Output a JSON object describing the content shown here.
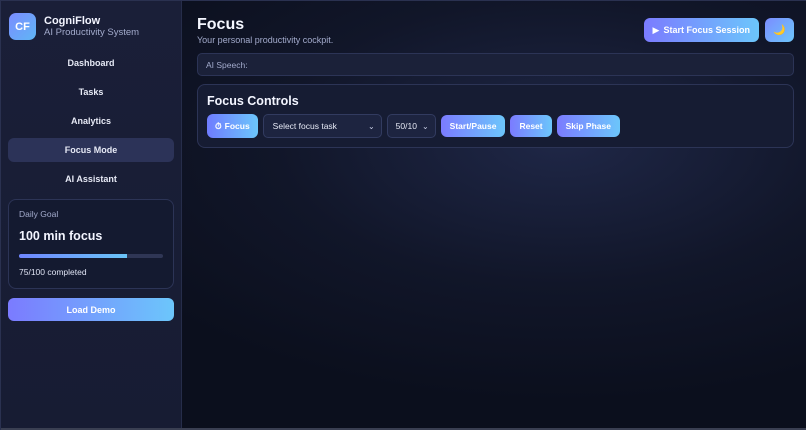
{
  "brand": {
    "logo_text": "CF",
    "name": "CogniFlow",
    "subtitle": "AI Productivity System"
  },
  "sidebar": {
    "items": [
      {
        "label": "Dashboard",
        "active": false
      },
      {
        "label": "Tasks",
        "active": false
      },
      {
        "label": "Analytics",
        "active": false
      },
      {
        "label": "Focus Mode",
        "active": true
      },
      {
        "label": "AI Assistant",
        "active": false
      }
    ],
    "goal": {
      "label": "Daily Goal",
      "value": "100 min focus",
      "progress_text": "75/100 completed",
      "progress_fraction": 0.75
    },
    "demo_label": "Load Demo"
  },
  "header": {
    "title": "Focus",
    "subtitle": "Your personal productivity cockpit.",
    "start_label": "Start Focus Session",
    "start_icon": "▶",
    "theme_icon": "🌙"
  },
  "speech": {
    "label": "AI Speech:"
  },
  "controls": {
    "title": "Focus Controls",
    "mode_icon": "⏱",
    "mode_label": "Focus",
    "task_select": "Select focus task",
    "duration_select": "50/10",
    "start_pause_label": "Start/Pause",
    "reset_label": "Reset",
    "skip_label": "Skip Phase"
  },
  "colors": {
    "accent_start": "#7b7bff",
    "accent_end": "#6cc6fb",
    "active_nav": "#2c3358"
  }
}
